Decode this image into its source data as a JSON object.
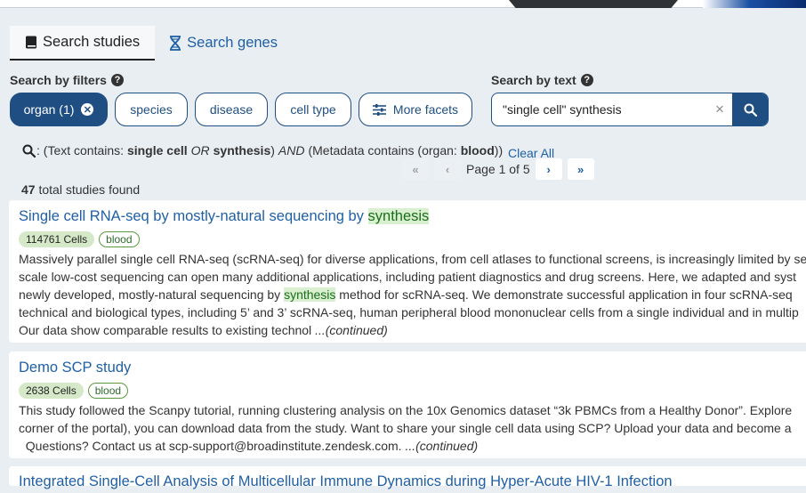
{
  "tabs": [
    {
      "label": "Search studies",
      "active": true,
      "icon": "book-icon"
    },
    {
      "label": "Search genes",
      "active": false,
      "icon": "dna-icon"
    }
  ],
  "filters": {
    "label": "Search by filters",
    "help": "?",
    "pills": [
      {
        "label": "organ (1)",
        "active": true
      },
      {
        "label": "species"
      },
      {
        "label": "disease"
      },
      {
        "label": "cell type"
      },
      {
        "label": "More facets",
        "icon": "sliders-icon"
      }
    ]
  },
  "text_search": {
    "label": "Search by text",
    "help": "?",
    "value": "\"single cell\" synthesis",
    "clear": "×"
  },
  "query": {
    "prefix": ": (Text contains: ",
    "term1": "single cell",
    "or": "OR",
    "term2": "synthesis",
    "close_and": ")",
    "and": "AND",
    "meta_open": "(Metadata contains (organ: ",
    "meta_val": "blood",
    "meta_close": "))",
    "clear_all": "Clear All"
  },
  "pager": {
    "first": "«",
    "prev": "‹",
    "text": "Page 1 of 5",
    "next": "›",
    "last": "»"
  },
  "results": {
    "count": "47",
    "count_suffix": " total studies found",
    "items": [
      {
        "title_pre": "Single cell RNA-seq by mostly-natural sequencing by ",
        "title_hl": "synthesis",
        "cells": "114761 Cells",
        "organ": "blood",
        "l1": "Massively parallel single cell RNA-seq (scRNA-seq) for diverse applications, from cell atlases to functional screens, is increasingly limited by se",
        "l2": "scale low-cost sequencing can open many additional applications, including patient diagnostics and drug screens. Here, we adapted and syst",
        "l3_pre": "newly developed, mostly-natural sequencing by ",
        "l3_hl": "synthesis",
        "l3_post": " method for scRNA-seq. We demonstrate successful application in four scRNA-seq",
        "l4": "technical and biological types, including 5’ and 3’ scRNA-seq, human peripheral blood mononuclear cells from a single individual and in multip",
        "l5": "Our data show comparable results to existing technol ",
        "continued": "...(continued)"
      },
      {
        "title": "Demo SCP study",
        "cells": "2638 Cells",
        "organ": "blood",
        "l1": "This study followed the Scanpy tutorial, running clustering analysis on the 10x Genomics dataset “3k PBMCs from a Healthy Donor”.  Explore",
        "l2": "corner of the portal), you can download data from the study.   Want to share your single cell data using SCP? Upload your data and become a",
        "l3": "  Questions? Contact us at scp-support@broadinstitute.zendesk.com. ",
        "continued": "...(continued)"
      },
      {
        "title": "Integrated Single-Cell Analysis of Multicellular Immune Dynamics during Hyper-Acute HIV-1 Infection"
      }
    ]
  }
}
